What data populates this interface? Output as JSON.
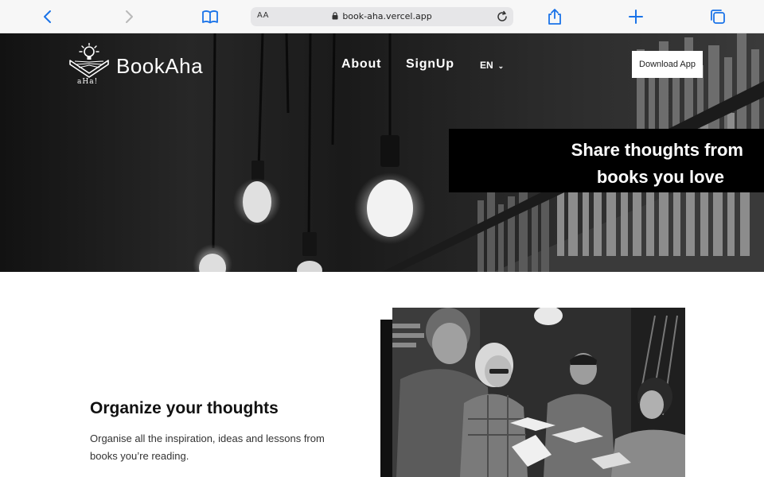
{
  "browser": {
    "address_aa": "AA",
    "url": "book-aha.vercel.app",
    "icons": [
      "back-icon",
      "forward-icon",
      "bookmarks-icon",
      "lock-icon",
      "reload-icon",
      "share-icon",
      "new-tab-icon",
      "tabs-icon"
    ]
  },
  "header": {
    "logo_text": "BookAha",
    "logo_sub": "aHa!",
    "nav": {
      "about": "About",
      "signup": "SignUp",
      "language": "EN"
    },
    "download_label": "Download App"
  },
  "hero": {
    "tagline_line1": "Share thoughts from",
    "tagline_line2": "books you love"
  },
  "feature": {
    "title": "Organize your thoughts",
    "description": "Organise all the inspiration, ideas and lessons from books you’re reading."
  },
  "colors": {
    "accent_blue": "#1a73e8",
    "hero_dark": "#121212",
    "text_dark": "#111111"
  }
}
